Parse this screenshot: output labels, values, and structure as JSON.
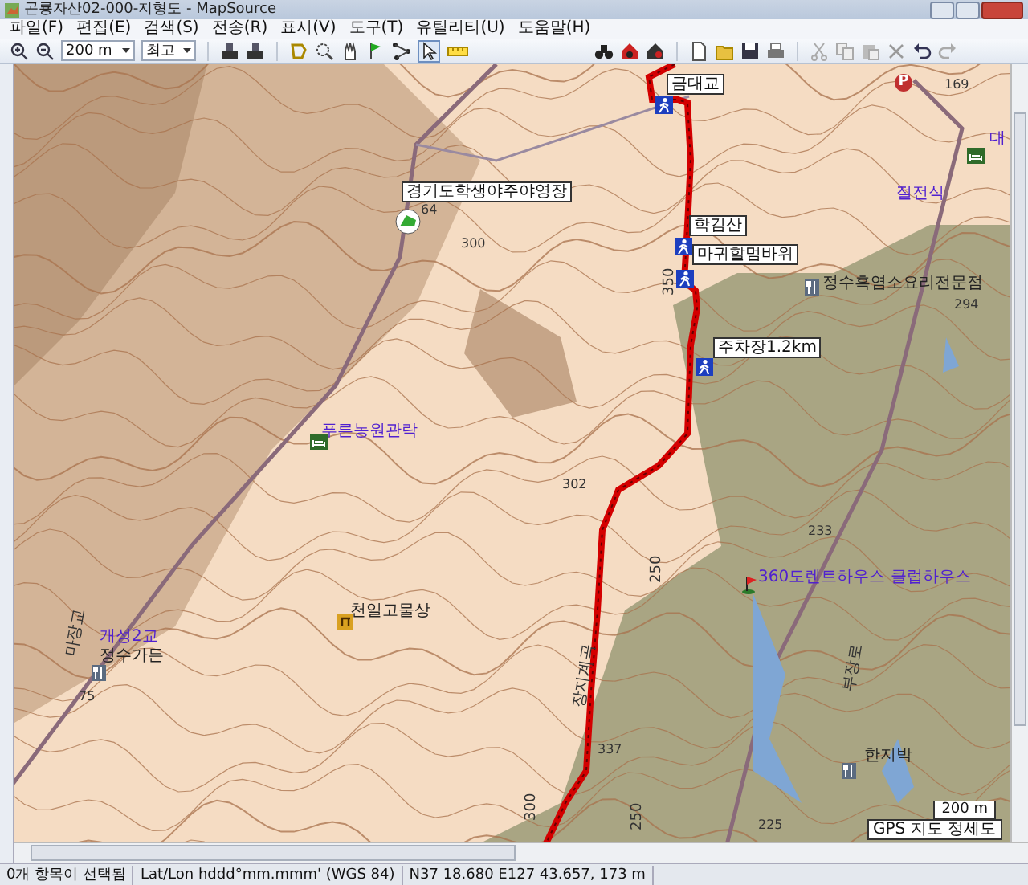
{
  "window": {
    "title": "곤룡자산02-000-지형도 - MapSource"
  },
  "menu": [
    "파일(F)",
    "편집(E)",
    "검색(S)",
    "전송(R)",
    "표시(V)",
    "도구(T)",
    "유틸리티(U)",
    "도움말(H)"
  ],
  "toolbar": {
    "scale": "200 m",
    "detail": "최고"
  },
  "map": {
    "labels": [
      {
        "text": "금대교",
        "kind": "waypoint"
      },
      {
        "text": "경기도학생야주야영장",
        "kind": "campsite"
      },
      {
        "text": "64",
        "kind": "peak"
      },
      {
        "text": "300",
        "kind": "peak"
      },
      {
        "text": "학김산",
        "kind": "waypoint"
      },
      {
        "text": "마귀할멈바위",
        "kind": "waypoint"
      },
      {
        "text": "350",
        "kind": "contour"
      },
      {
        "text": "주차장1.2km",
        "kind": "waypoint"
      },
      {
        "text": "P",
        "kind": "parking"
      },
      {
        "text": "169",
        "kind": "peak"
      },
      {
        "text": "대",
        "kind": "lodging"
      },
      {
        "text": "절전식",
        "kind": "place"
      },
      {
        "text": "정수흑염소요리전문점",
        "kind": "restaurant"
      },
      {
        "text": "294",
        "kind": "peak"
      },
      {
        "text": "푸른농원관락",
        "kind": "lodging"
      },
      {
        "text": "302",
        "kind": "peak"
      },
      {
        "text": "천일고물상",
        "kind": "shop"
      },
      {
        "text": "개성2교",
        "kind": "place"
      },
      {
        "text": "마장교",
        "kind": "road"
      },
      {
        "text": "정수가든",
        "kind": "restaurant"
      },
      {
        "text": "75",
        "kind": "peak"
      },
      {
        "text": "233",
        "kind": "peak"
      },
      {
        "text": "360도렌트하우스 클럽하우스",
        "kind": "flag"
      },
      {
        "text": "250",
        "kind": "contour"
      },
      {
        "text": "장지계곡",
        "kind": "road"
      },
      {
        "text": "부장로",
        "kind": "road"
      },
      {
        "text": "337",
        "kind": "peak"
      },
      {
        "text": "한지박",
        "kind": "restaurant"
      },
      {
        "text": "300",
        "kind": "contour"
      },
      {
        "text": "250",
        "kind": "contour"
      },
      {
        "text": "225",
        "kind": "peak"
      }
    ],
    "scale_bar": "200 m",
    "map_name": "GPS 지도 정세도"
  },
  "status_bar": {
    "selection": "0개 항목이 선택됨",
    "format": "Lat/Lon hddd°mm.mmm' (WGS 84)",
    "position": "N37 18.680 E127 43.657, 173 m"
  }
}
